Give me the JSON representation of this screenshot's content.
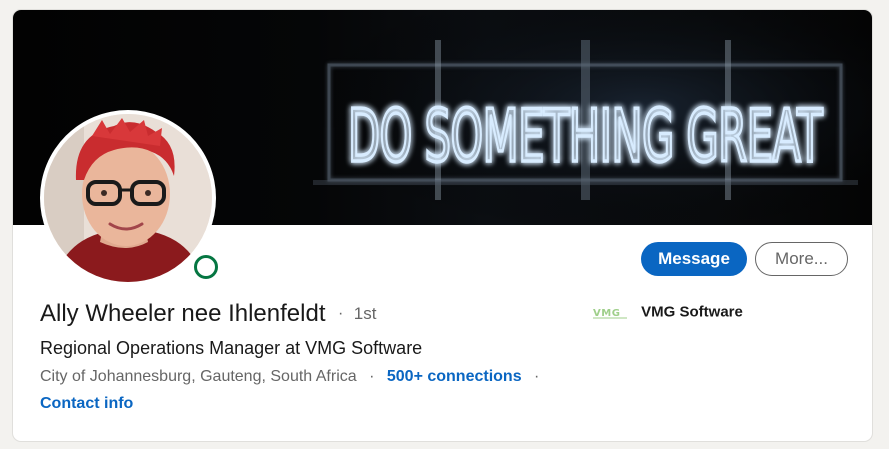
{
  "banner": {
    "neon_text": "DO SOMETHING GREAT",
    "neon_color": "#cfe6ff"
  },
  "profile": {
    "name": "Ally Wheeler nee Ihlenfeldt",
    "separator": "·",
    "degree": "1st",
    "headline": "Regional Operations Manager at VMG Software",
    "location": "City of Johannesburg, Gauteng, South Africa",
    "connections": "500+ connections",
    "contact_info": "Contact info",
    "presence_status_color": "#057642"
  },
  "actions": {
    "message_label": "Message",
    "more_label": "More..."
  },
  "company": {
    "logo_text": "VMG",
    "name": "VMG Software"
  },
  "colors": {
    "primary": "#0a66c2",
    "background": "#f3f2ef",
    "text_secondary": "#666666"
  }
}
